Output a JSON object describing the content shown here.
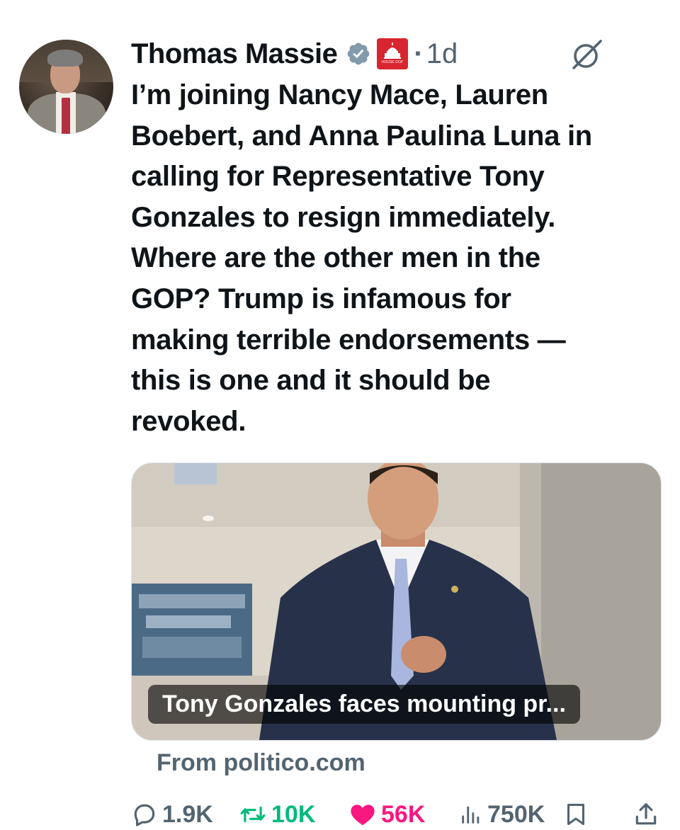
{
  "author": {
    "name": "Thomas Massie",
    "verified_icon": "verified-badge-icon",
    "affiliate_badge": "house-gop-badge",
    "affiliate_badge_text": "HOUSE GOP",
    "time": "1d",
    "separator": "·"
  },
  "tweet": {
    "text": "I’m joining Nancy Mace, Lauren\nBoebert, and Anna Paulina Luna in\ncalling for Representative Tony\nGonzales to resign immediately.\nWhere are the other men in the\nGOP? Trump is infamous for\nmaking terrible endorsements —\nthis is one and it should be\nrevoked."
  },
  "link_card": {
    "title": "Tony Gonzales faces mounting pr...",
    "source": "From politico.com"
  },
  "actions": {
    "replies": "1.9K",
    "retweets": "10K",
    "likes": "56K",
    "views": "750K"
  },
  "colors": {
    "text": "#0f1419",
    "secondary": "#536471",
    "retweet": "#00ba7c",
    "like": "#f91880",
    "verified": "#829aab",
    "gop_badge": "#d7262f"
  }
}
